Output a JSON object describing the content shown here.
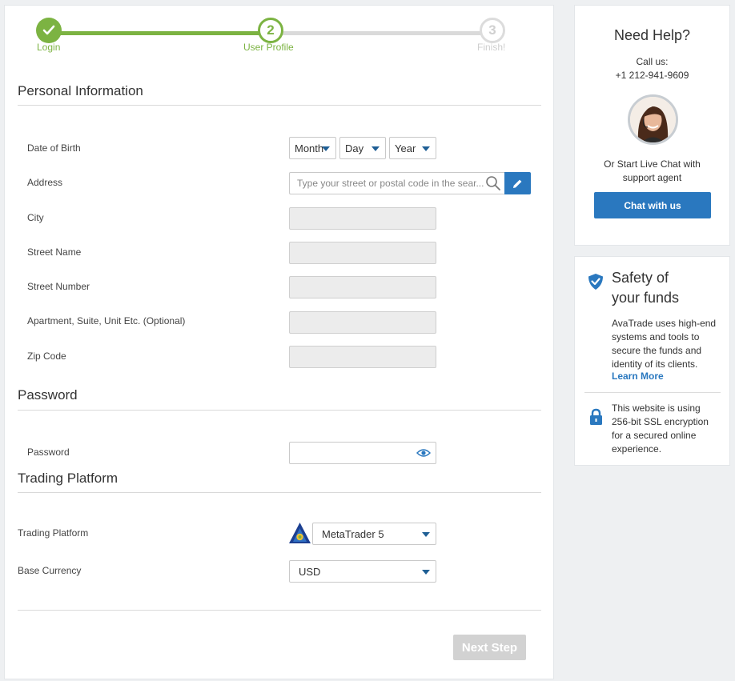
{
  "stepper": {
    "step1": {
      "label": "Login",
      "state": "done"
    },
    "step2": {
      "number": "2",
      "label": "User Profile",
      "state": "current"
    },
    "step3": {
      "number": "3",
      "label": "Finish!",
      "state": "pending"
    }
  },
  "personal": {
    "title": "Personal Information",
    "dob": {
      "label": "Date of Birth",
      "month": "Month",
      "day": "Day",
      "year": "Year"
    },
    "address": {
      "label": "Address",
      "placeholder": "Type your street or postal code in the sear..."
    },
    "city": {
      "label": "City"
    },
    "street_name": {
      "label": "Street Name"
    },
    "street_number": {
      "label": "Street Number"
    },
    "apartment": {
      "label": "Apartment, Suite, Unit Etc. (Optional)"
    },
    "zip": {
      "label": "Zip Code"
    }
  },
  "password_section": {
    "title": "Password",
    "password": {
      "label": "Password"
    }
  },
  "trading": {
    "title": "Trading Platform",
    "platform": {
      "label": "Trading Platform",
      "value": "MetaTrader 5"
    },
    "currency": {
      "label": "Base Currency",
      "value": "USD"
    }
  },
  "actions": {
    "next_label": "Next Step"
  },
  "help": {
    "title": "Need Help?",
    "call_label": "Call us:",
    "phone": "+1 212-941-9609",
    "chat_prompt_line1": "Or Start Live Chat with",
    "chat_prompt_line2": "support agent",
    "chat_button": "Chat with us"
  },
  "safety": {
    "title_line1": "Safety of",
    "title_line2": "your funds",
    "body_lines": [
      "AvaTrade uses high-end",
      "systems and tools to",
      "secure the funds and",
      "identity of its clients."
    ],
    "learn_more": "Learn More",
    "ssl_lines": [
      "This website is using",
      "256-bit SSL encryption",
      "for a secured online",
      "experience."
    ]
  },
  "colors": {
    "progress_green": "#7cb342",
    "brand_blue": "#2a78bf",
    "disabled_gray": "#d2d2d2"
  },
  "icons": {
    "step_done": "check-icon",
    "search": "search-icon",
    "edit": "pencil-icon",
    "password_visibility": "eye-icon",
    "dropdown": "caret-down-icon",
    "safety": "shield-check-icon",
    "ssl": "lock-icon"
  }
}
